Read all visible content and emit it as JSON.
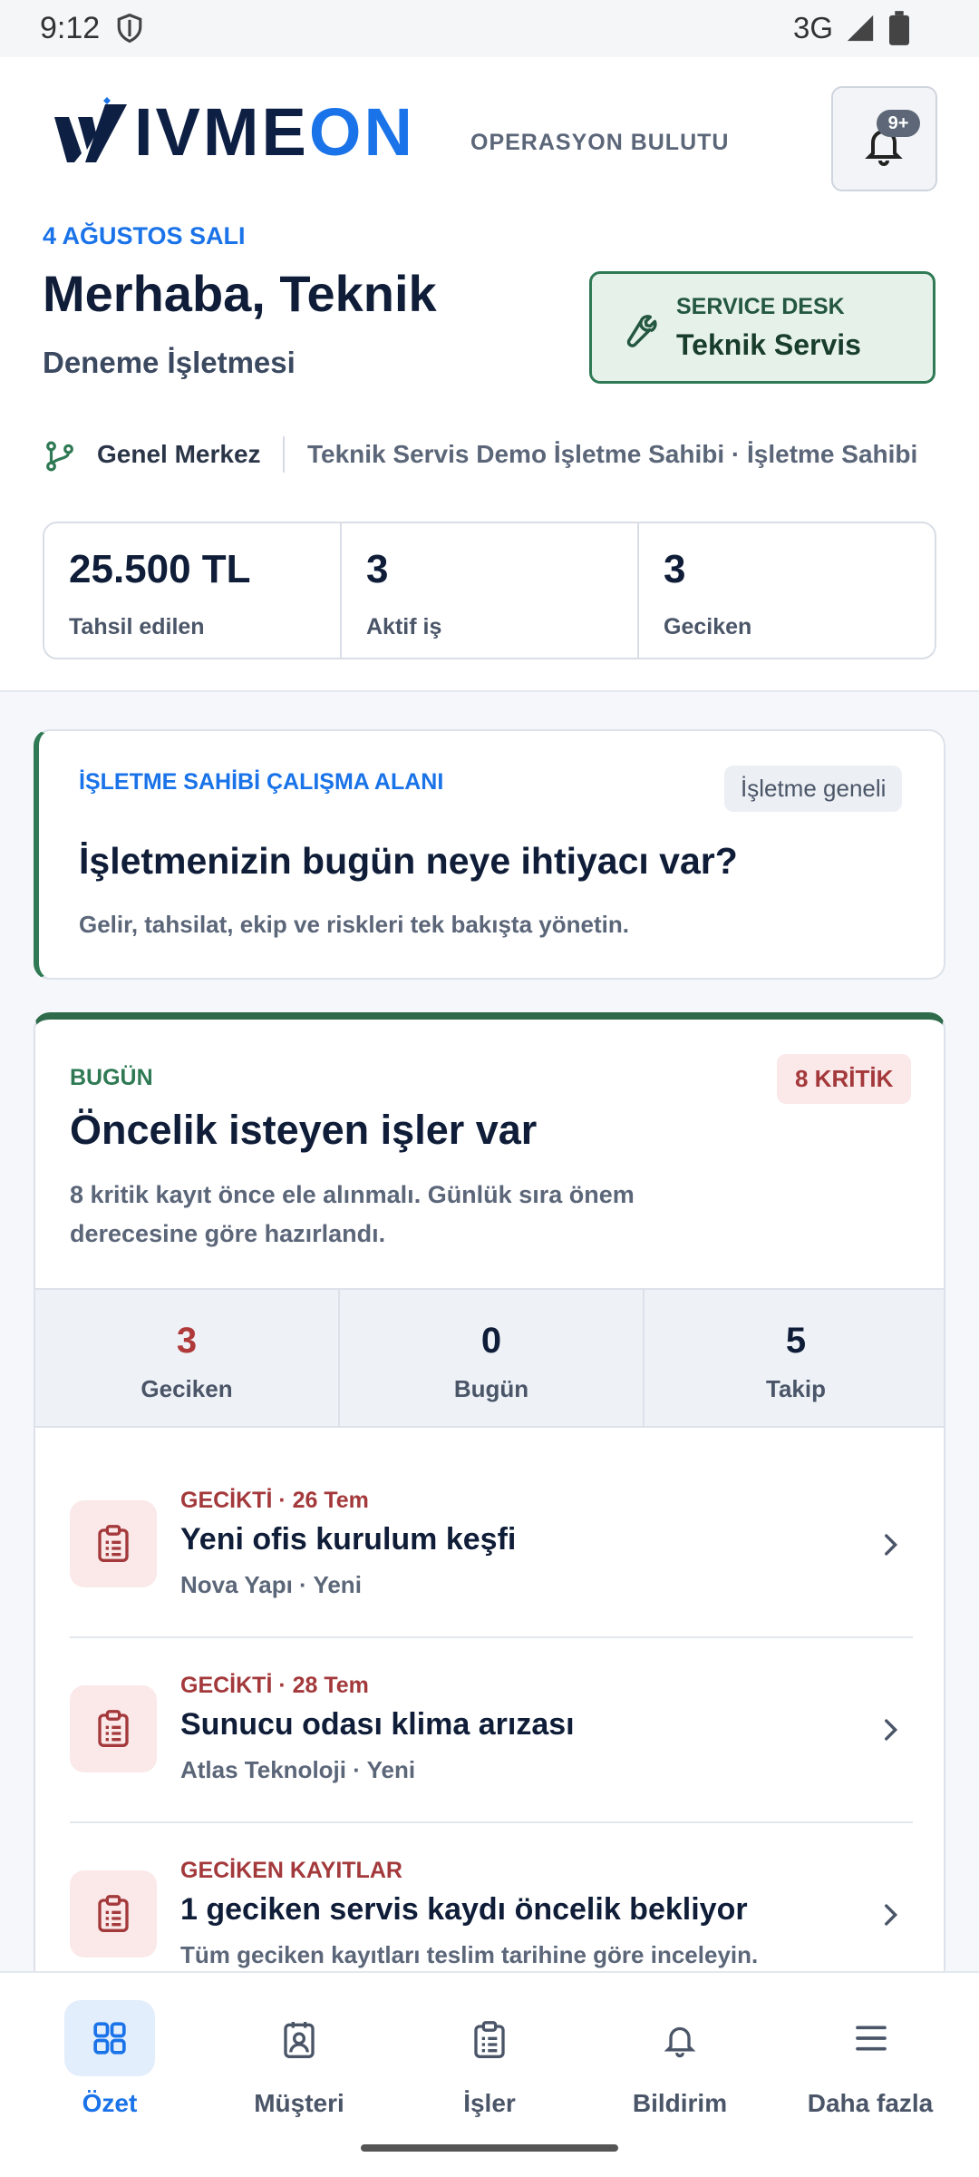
{
  "status_bar": {
    "time": "9:12",
    "network": "3G",
    "icons": [
      "shield-icon",
      "signal-icon",
      "battery-icon"
    ]
  },
  "header": {
    "logo": {
      "text_main": "IVME",
      "text_accent": "ON"
    },
    "tagline": "OPERASYON BULUTU",
    "notifications": {
      "badge": "9+",
      "icon": "bell-icon"
    },
    "date": "4 AĞUSTOS SALI",
    "greeting": "Merhaba, Teknik",
    "business_name": "Deneme İşletmesi",
    "service_desk": {
      "label": "SERVICE DESK",
      "name": "Teknik Servis",
      "icon": "wrench-icon"
    },
    "branch": {
      "name": "Genel Merkez",
      "owner": "Teknik Servis Demo İşletme Sahibi · İşletme Sahibi",
      "icon": "branch-icon"
    },
    "stats": [
      {
        "value": "25.500 TL",
        "label": "Tahsil edilen"
      },
      {
        "value": "3",
        "label": "Aktif iş"
      },
      {
        "value": "3",
        "label": "Geciken"
      }
    ]
  },
  "workspace": {
    "label": "İŞLETME SAHİBİ ÇALIŞMA ALANI",
    "chip": "İşletme geneli",
    "title": "İşletmenizin bugün neye ihtiyacı var?",
    "description": "Gelir, tahsilat, ekip ve riskleri tek bakışta yönetin."
  },
  "today": {
    "label": "BUGÜN",
    "badge": "8 KRİTİK",
    "title": "Öncelik isteyen işler var",
    "description": "8 kritik kayıt önce ele alınmalı. Günlük sıra önem derecesine göre hazırlandı.",
    "counters": [
      {
        "value": "3",
        "label": "Geciken"
      },
      {
        "value": "0",
        "label": "Bugün"
      },
      {
        "value": "5",
        "label": "Takip"
      }
    ],
    "tasks": [
      {
        "meta": "GECİKTİ · 26 Tem",
        "title": "Yeni ofis kurulum keşfi",
        "sub": "Nova Yapı · Yeni"
      },
      {
        "meta": "GECİKTİ · 28 Tem",
        "title": "Sunucu odası klima arızası",
        "sub": "Atlas Teknoloji · Yeni"
      },
      {
        "meta": "GECİKEN KAYITLAR",
        "title": "1 geciken servis kaydı öncelik bekliyor",
        "sub": "Tüm geciken kayıtları teslim tarihine göre inceleyin."
      }
    ]
  },
  "bottom_nav": [
    {
      "label": "Özet",
      "icon": "dashboard-icon",
      "active": true
    },
    {
      "label": "Müşteri",
      "icon": "customer-icon",
      "active": false
    },
    {
      "label": "İşler",
      "icon": "clipboard-icon",
      "active": false
    },
    {
      "label": "Bildirim",
      "icon": "bell-icon",
      "active": false
    },
    {
      "label": "Daha fazla",
      "icon": "menu-icon",
      "active": false
    }
  ],
  "colors": {
    "accent": "#1a73e8",
    "brand_dark": "#0e1f44",
    "success": "#2f7a55",
    "danger": "#a3393b"
  }
}
